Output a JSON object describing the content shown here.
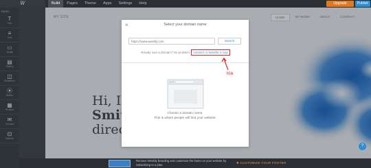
{
  "topbar": {
    "logo": "W",
    "nav": [
      "Build",
      "Pages",
      "Theme",
      "Apps",
      "Settings",
      "Help"
    ],
    "upgrade_label": "Upgrade",
    "publish_label": "Publish"
  },
  "sidebar": {
    "heading": "BASIC",
    "tools": [
      {
        "icon": "T",
        "label": "Title"
      },
      {
        "icon": "≡",
        "label": "Text"
      },
      {
        "icon": "▭",
        "label": "Image"
      },
      {
        "icon": "▤",
        "label": "Gallery"
      },
      {
        "icon": "◫",
        "label": "Slideshow"
      },
      {
        "icon": "⦿",
        "label": "Button"
      },
      {
        "icon": "▦",
        "label": "Product"
      },
      {
        "icon": "✉",
        "label": "Contact"
      },
      {
        "icon": "⊡",
        "label": "Section"
      }
    ]
  },
  "site": {
    "title": "MY SITE",
    "nav": [
      "HOME",
      "MY WORK",
      "ABOUT",
      "CONTACT"
    ],
    "hero_line1": "Hi, I'",
    "hero_line2": "Smit",
    "hero_line3": "direc"
  },
  "modal": {
    "title": "Select your domain name",
    "close": "×",
    "input_placeholder": "https://www.weebly.com",
    "search_label": "Search",
    "already_text": "Already own a domain? No problem,",
    "connect_link": "connect or transfer it now",
    "choose_line1": "Choose a domain name.",
    "choose_line2": "This is where people will find your website."
  },
  "annotation": {
    "label": "Klik",
    "color": "#e02424"
  },
  "bottombar": {
    "promo_text": "Remove Weebly branding and customize the footer on your website by subscribing to a plan.",
    "cta": "CUSTOMIZE YOUR FOOTER"
  },
  "help": "?",
  "colors": {
    "accent": "#2a8fd6",
    "upgrade": "#e07a1f",
    "annotation": "#e02424"
  }
}
